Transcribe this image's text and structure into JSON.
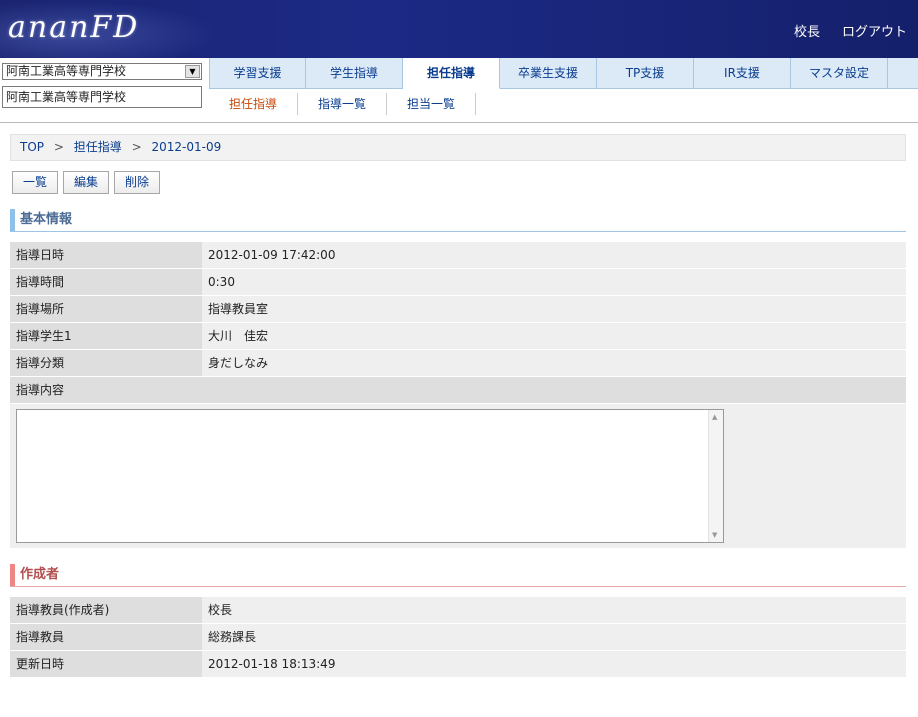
{
  "header": {
    "logo": "ananFD",
    "user_name": "校長",
    "logout_label": "ログアウト"
  },
  "school": {
    "select_value": "阿南工業高等専門学校",
    "field_value": "阿南工業高等専門学校"
  },
  "tabs": [
    {
      "label": "学習支援",
      "active": false
    },
    {
      "label": "学生指導",
      "active": false
    },
    {
      "label": "担任指導",
      "active": true
    },
    {
      "label": "卒業生支援",
      "active": false
    },
    {
      "label": "TP支援",
      "active": false
    },
    {
      "label": "IR支援",
      "active": false
    },
    {
      "label": "マスタ設定",
      "active": false
    }
  ],
  "subnav": [
    {
      "label": "担任指導",
      "active": true
    },
    {
      "label": "指導一覧",
      "active": false
    },
    {
      "label": "担当一覧",
      "active": false
    }
  ],
  "breadcrumb": {
    "items": [
      "TOP",
      "担任指導",
      "2012-01-09"
    ],
    "separator": ">"
  },
  "actions": {
    "list_label": "一覧",
    "edit_label": "編集",
    "delete_label": "削除"
  },
  "basic_info": {
    "title": "基本情報",
    "rows": [
      {
        "label": "指導日時",
        "value": "2012-01-09 17:42:00"
      },
      {
        "label": "指導時間",
        "value": "0:30"
      },
      {
        "label": "指導場所",
        "value": "指導教員室"
      },
      {
        "label": "指導学生1",
        "value": "大川　佳宏"
      },
      {
        "label": "指導分類",
        "value": "身だしなみ"
      }
    ],
    "content_label": "指導内容",
    "content_value": ""
  },
  "creator": {
    "title": "作成者",
    "rows": [
      {
        "label": "指導教員(作成者)",
        "value": "校長"
      },
      {
        "label": "指導教員",
        "value": "総務課長"
      },
      {
        "label": "更新日時",
        "value": "2012-01-18 18:13:49"
      }
    ]
  },
  "colors": {
    "header_bg": "#1c2a86",
    "tab_bg": "#dce9f6",
    "link": "#0a3d8f",
    "active_sub": "#c64a10",
    "section_blue": "#8ec0e8",
    "section_red": "#ee8686"
  }
}
